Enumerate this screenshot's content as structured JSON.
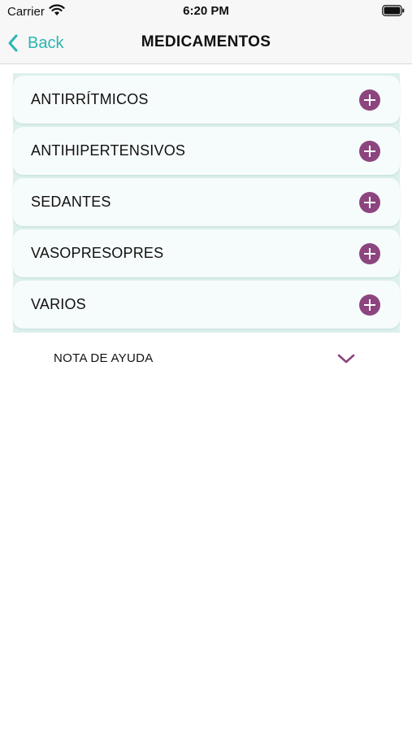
{
  "status_bar": {
    "carrier": "Carrier",
    "time": "6:20 PM"
  },
  "nav": {
    "back_label": "Back",
    "title": "MEDICAMENTOS"
  },
  "categories": [
    {
      "label": "ANTIRRÍTMICOS",
      "icon": "plus-circle-icon"
    },
    {
      "label": "ANTIHIPERTENSIVOS",
      "icon": "plus-circle-icon"
    },
    {
      "label": "SEDANTES",
      "icon": "plus-circle-icon"
    },
    {
      "label": "VASOPRESOPRES",
      "icon": "plus-circle-icon"
    },
    {
      "label": "VARIOS",
      "icon": "plus-circle-icon"
    }
  ],
  "help": {
    "label": "NOTA DE AYUDA",
    "icon": "chevron-down-icon"
  },
  "colors": {
    "accent_teal": "#2bb6b0",
    "accent_purple": "#8c457e",
    "list_background": "#ddf0ed",
    "item_background": "#f6fbfb"
  }
}
